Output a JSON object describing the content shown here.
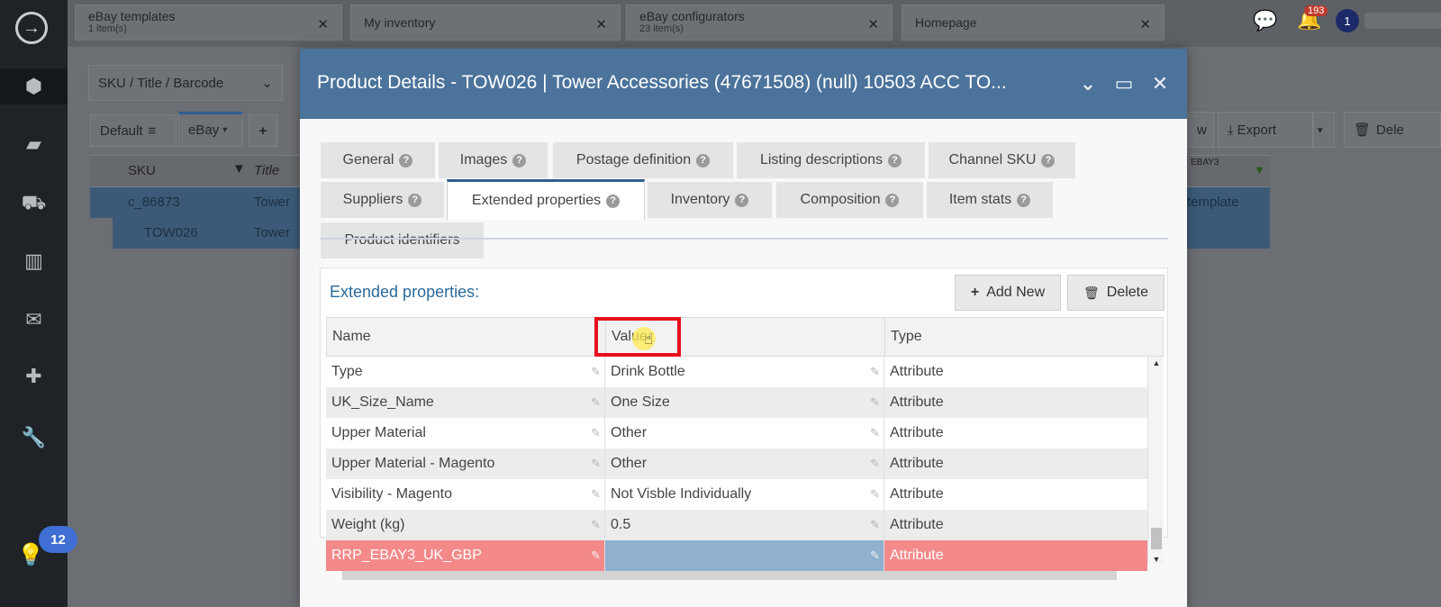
{
  "sidebar": {
    "logo_glyph": "→",
    "notification_count": "12"
  },
  "topbar": {
    "tabs": [
      {
        "title": "eBay templates",
        "subtitle": "1 item(s)"
      },
      {
        "title": "My inventory",
        "subtitle": ""
      },
      {
        "title": "eBay configurators",
        "subtitle": "23 item(s)"
      },
      {
        "title": "Homepage",
        "subtitle": ""
      }
    ],
    "bell_count": "193",
    "user_initial": "1"
  },
  "background": {
    "search_select": "SKU / Title / Barcode",
    "view_default": "Default",
    "view_ebay": "eBay",
    "add_view": "+",
    "col_sku": "SKU",
    "col_title": "Title",
    "row1_sku": "c_86873",
    "row1_title": "Tower",
    "row2_sku": "TOW026",
    "row2_title": "Tower",
    "export_label": "Export",
    "delete_label": "Dele",
    "right_col_header": "EBAY3",
    "right_cell": "template",
    "partial_w": "w"
  },
  "modal": {
    "title": "Product Details - TOW026 | Tower Accessories (47671508) (null) 10503 ACC TO...",
    "tabs_row1": [
      "General",
      "Images",
      "Postage definition",
      "Listing descriptions",
      "Channel SKU"
    ],
    "tabs_row2": [
      "Suppliers",
      "Extended properties",
      "Inventory",
      "Composition",
      "Item stats"
    ],
    "tabs_row3": [
      "Product identifiers"
    ],
    "active_tab": "Extended properties",
    "panel": {
      "title": "Extended properties:",
      "add_new": "Add New",
      "delete": "Delete",
      "columns": [
        "Name",
        "Value",
        "Type"
      ],
      "rows": [
        {
          "name": "Type",
          "value": "Drink Bottle",
          "type": "Attribute"
        },
        {
          "name": "UK_Size_Name",
          "value": "One Size",
          "type": "Attribute"
        },
        {
          "name": "Upper Material",
          "value": "Other",
          "type": "Attribute"
        },
        {
          "name": "Upper Material - Magento",
          "value": "Other",
          "type": "Attribute"
        },
        {
          "name": "Visibility - Magento",
          "value": "Not Visble Individually",
          "type": "Attribute"
        },
        {
          "name": "Weight (kg)",
          "value": "0.5",
          "type": "Attribute"
        },
        {
          "name": "RRP_EBAY3_UK_GBP",
          "value": "",
          "type": "Attribute"
        }
      ]
    }
  },
  "colors": {
    "modal_header": "#4b739b",
    "selected_row": "#f4898a",
    "selected_value_cell": "#8fb0cf",
    "highlight_box": "#e8101c"
  }
}
